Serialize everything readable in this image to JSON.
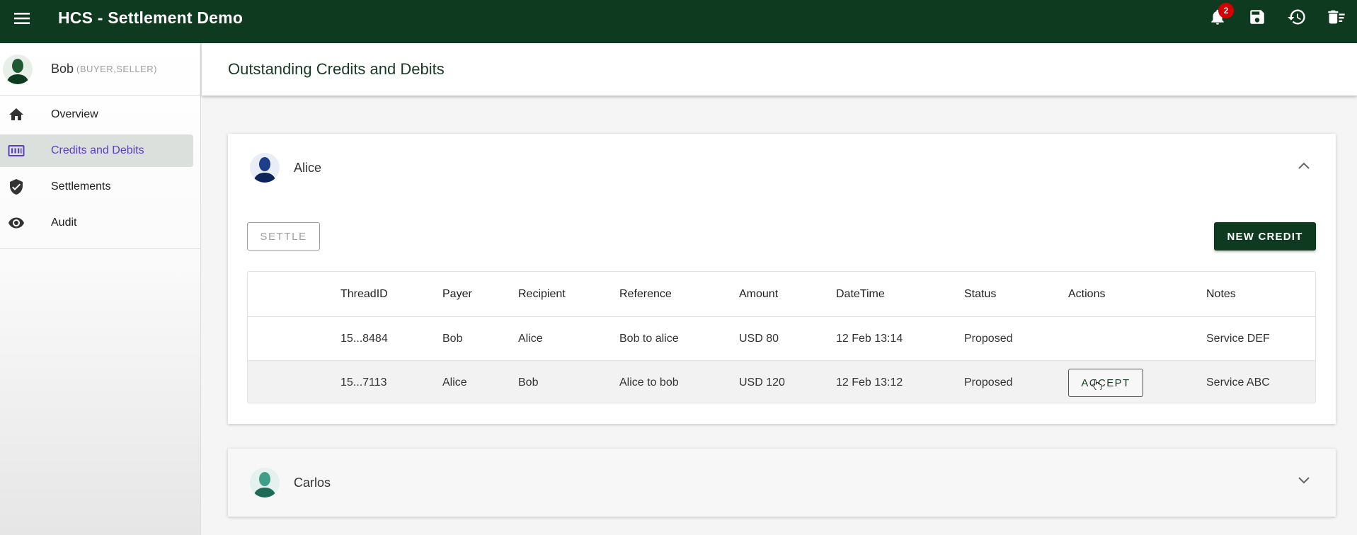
{
  "app": {
    "title": "HCS - Settlement Demo",
    "notification_count": "2",
    "brand_color": "#0e3a1f",
    "actions": [
      "notifications-icon",
      "save-icon",
      "history-icon",
      "delete-icon"
    ]
  },
  "user": {
    "name": "Bob",
    "roles": "(BUYER,SELLER)"
  },
  "nav": {
    "items": [
      {
        "label": "Overview",
        "icon": "home-icon"
      },
      {
        "label": "Credits and Debits",
        "icon": "credits-icon"
      },
      {
        "label": "Settlements",
        "icon": "shield-check-icon"
      },
      {
        "label": "Audit",
        "icon": "eye-icon"
      }
    ],
    "active": "Credits and Debits"
  },
  "page": {
    "title": "Outstanding Credits and Debits"
  },
  "panels": [
    {
      "name": "Alice",
      "expanded": true,
      "settle_label": "SETTLE",
      "new_credit_label": "NEW CREDIT",
      "table": {
        "columns": [
          "ThreadID",
          "Payer",
          "Recipient",
          "Reference",
          "Amount",
          "DateTime",
          "Status",
          "Actions",
          "Notes"
        ],
        "rows": [
          {
            "thread": "15...8484",
            "payer": "Bob",
            "recipient": "Alice",
            "reference": "Bob to alice",
            "amount": "USD 80",
            "datetime": "12 Feb 13:14",
            "status": "Proposed",
            "action": "",
            "notes": "Service DEF"
          },
          {
            "thread": "15...7113",
            "payer": "Alice",
            "recipient": "Bob",
            "reference": "Alice to bob",
            "amount": "USD 120",
            "datetime": "12 Feb 13:12",
            "status": "Proposed",
            "action": "ACCEPT",
            "notes": "Service ABC"
          }
        ]
      }
    },
    {
      "name": "Carlos",
      "expanded": false
    }
  ]
}
